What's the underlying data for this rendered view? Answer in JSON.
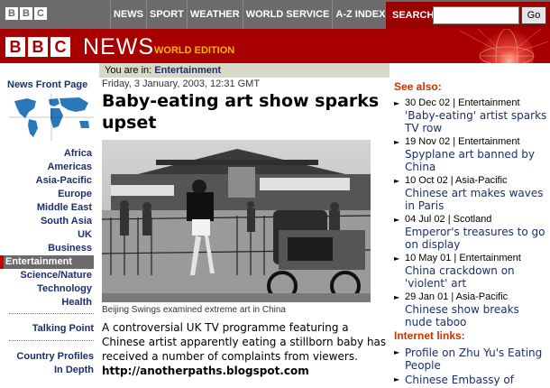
{
  "topbar": {
    "logo_letters": [
      "B",
      "B",
      "C"
    ],
    "nav_items": [
      "NEWS",
      "SPORT",
      "WEATHER",
      "WORLD SERVICE",
      "A-Z INDEX"
    ],
    "search_label": "SEARCH",
    "search_value": "",
    "go_label": "Go"
  },
  "masthead": {
    "logo_letters": [
      "B",
      "B",
      "C"
    ],
    "news_word": "NEWS",
    "edition": "WORLD EDITION"
  },
  "leftnav": {
    "front_page": "News Front Page",
    "items": [
      "Africa",
      "Americas",
      "Asia-Pacific",
      "Europe",
      "Middle East",
      "South Asia",
      "UK",
      "Business",
      "Entertainment",
      "Science/Nature",
      "Technology",
      "Health"
    ],
    "active": "Entertainment",
    "talking_point": "Talking Point",
    "country_profiles_1": "Country Profiles",
    "country_profiles_2": "In Depth"
  },
  "breadcrumb": {
    "prefix": "You are in:",
    "section": "Entertainment"
  },
  "article": {
    "date": "Friday, 3 January, 2003, 12:31 GMT",
    "headline": "Baby-eating art show sparks upset",
    "caption": "Beijing Swings examined extreme art in China",
    "body": "A controversial UK TV programme featuring a Chinese artist apparently eating a stillborn baby has received a number of complaints from viewers.",
    "watermark": "http://anotherpaths.blogspot.com"
  },
  "see_also": {
    "heading": "See also:",
    "items": [
      {
        "meta": "30 Dec 02 | Entertainment",
        "title": "'Baby-eating' artist sparks TV row"
      },
      {
        "meta": "19 Nov 02 | Entertainment",
        "title": "Spyplane art banned by China"
      },
      {
        "meta": "10 Oct 02 | Asia-Pacific",
        "title": "Chinese art makes waves in Paris"
      },
      {
        "meta": "04 Jul 02 | Scotland",
        "title": "Emperor's treasures to go on display"
      },
      {
        "meta": "10 May 01 | Entertainment",
        "title": "China crackdown on 'violent' art"
      },
      {
        "meta": "29 Jan 01 | Asia-Pacific",
        "title": "Chinese show breaks nude taboo"
      }
    ]
  },
  "internet_links": {
    "heading": "Internet links:",
    "items": [
      "Profile on Zhu Yu's Eating People",
      "Chinese Embassy of"
    ]
  },
  "colors": {
    "brand_red": "#a80000",
    "link_blue": "#1c2f6b",
    "heading_orange": "#cc3300",
    "nav_gray": "#6b6b6b"
  }
}
